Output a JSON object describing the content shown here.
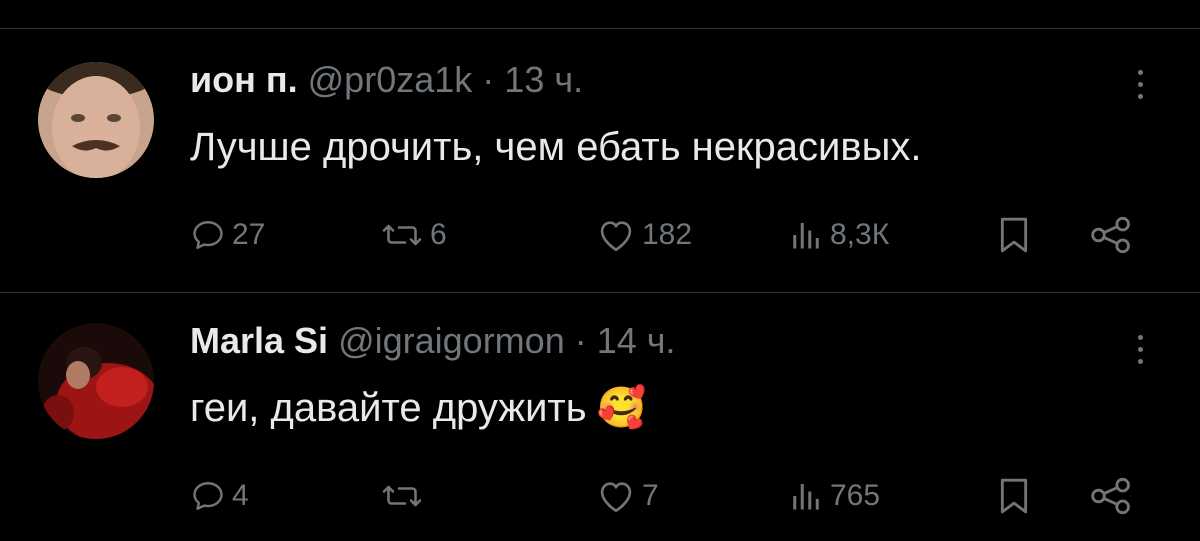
{
  "tweets": [
    {
      "name": "ион п.",
      "handle": "@pr0za1k",
      "separator": "·",
      "time": "13 ч.",
      "text": "Лучше дрочить, чем ебать некрасивых.",
      "replies": "27",
      "reposts": "6",
      "likes": "182",
      "views": "8,3К",
      "avatar_icon": "avatar-man-mustache"
    },
    {
      "name": "Marla Si",
      "handle": "@igraigormon",
      "separator": "·",
      "time": "14 ч.",
      "text": "геи, давайте дружить",
      "emoji": "🥰",
      "replies": "4",
      "reposts": "",
      "likes": "7",
      "views": "765",
      "avatar_icon": "avatar-woman-red"
    }
  ],
  "icons": {
    "reply": "reply-icon",
    "repost": "repost-icon",
    "like": "heart-icon",
    "views": "views-icon",
    "bookmark": "bookmark-icon",
    "share": "share-icon",
    "more": "more-icon"
  },
  "colors": {
    "background": "#000000",
    "text": "#e7e9ea",
    "muted": "#71767b",
    "divider": "#2f3336"
  }
}
